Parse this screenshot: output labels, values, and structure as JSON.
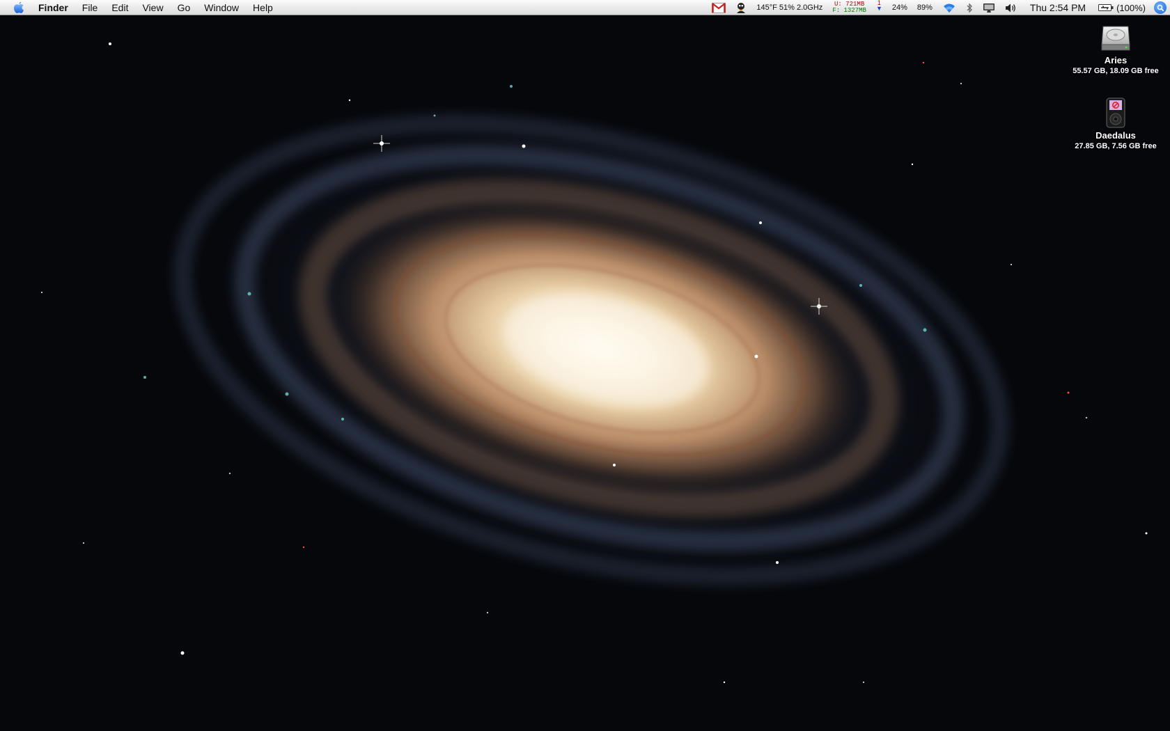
{
  "menubar": {
    "app_name": "Finder",
    "menus": [
      "File",
      "Edit",
      "View",
      "Go",
      "Window",
      "Help"
    ],
    "status": {
      "temp_cpu": "145°F 51% 2.0GHz",
      "net_up_label": "U:",
      "net_up_value": "721MB",
      "net_free_label": "F:",
      "net_free_value": "1327MB",
      "arrows_count": "1",
      "cpu_percent": "24%",
      "mem_percent": "89%",
      "clock": "Thu 2:54 PM",
      "battery": "(100%)"
    }
  },
  "desktop": {
    "icons": [
      {
        "name": "Aries",
        "info": "55.57 GB, 18.09 GB free",
        "icon": "hard-drive-icon"
      },
      {
        "name": "Daedalus",
        "info": "27.85 GB, 7.56 GB free",
        "icon": "ipod-icon"
      }
    ]
  },
  "colors": {
    "menubar_bg": "#e9e9e9",
    "spotlight": "#1863d6",
    "gmail_red": "#c5221f",
    "wallpaper_core": "#fff6e4",
    "wallpaper_dust": "#8a4a2a",
    "wallpaper_arm": "#3a5a80"
  }
}
